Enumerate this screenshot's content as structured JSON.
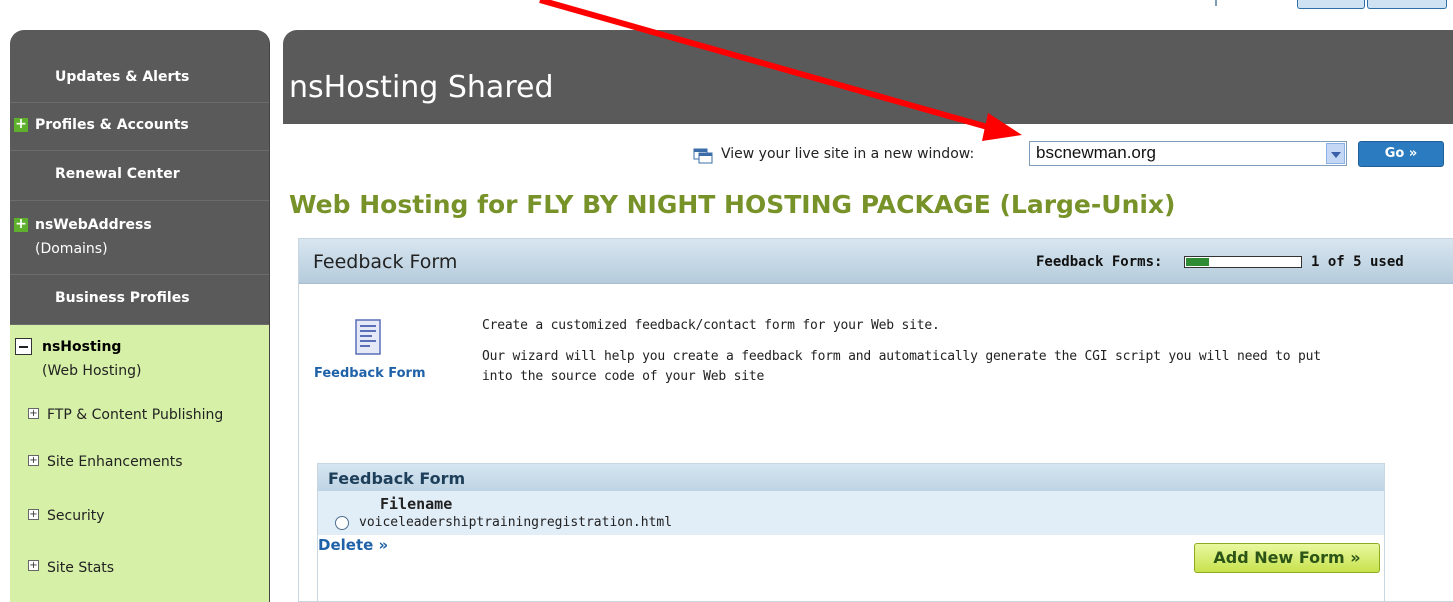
{
  "sidebar": {
    "items": [
      {
        "label": "Updates & Alerts"
      },
      {
        "label": "Profiles & Accounts"
      },
      {
        "label": "Renewal Center"
      },
      {
        "label": "nsWebAddress",
        "sub": "(Domains)"
      },
      {
        "label": "Business Profiles"
      },
      {
        "label": "nsHosting",
        "sub": "(Web Hosting)"
      }
    ],
    "subitems": [
      {
        "label": "FTP & Content Publishing"
      },
      {
        "label": "Site Enhancements"
      },
      {
        "label": "Security"
      },
      {
        "label": "Site Stats"
      }
    ]
  },
  "header": {
    "title": "nsHosting Shared"
  },
  "live_site": {
    "label": "View your live site in a new window:",
    "selected": "bscnewman.org",
    "go_label": "Go »"
  },
  "hosting_heading": "Web Hosting for FLY BY NIGHT HOSTING PACKAGE (Large-Unix)",
  "panel": {
    "title": "Feedback Form",
    "usage_label": "Feedback Forms:",
    "usage_count": "1 of 5 used",
    "usage_used": 1,
    "usage_total": 5,
    "icon_caption": "Feedback Form",
    "desc1": "Create a customized feedback/contact form for your Web site.",
    "desc2": "Our wizard will help you create a feedback form and automatically generate the CGI script you will need to put into the source code of your Web site",
    "list": {
      "title": "Feedback Form",
      "column": "Filename",
      "files": [
        "voiceleadershiptrainingregistration.html"
      ],
      "delete_label": "Delete »",
      "add_label": "Add New Form"
    }
  },
  "colors": {
    "sidebar_bg": "#5a5a5a",
    "sidebar_active": "#d6f0a8",
    "heading_green": "#78922a",
    "link_blue": "#1f62a8",
    "arrow_red": "#ff0000"
  },
  "icons": [
    "plus-icon",
    "minus-icon",
    "window-icon",
    "dropdown-arrow-icon",
    "feedback-form-icon",
    "radio-icon",
    "double-chevron-icon"
  ]
}
